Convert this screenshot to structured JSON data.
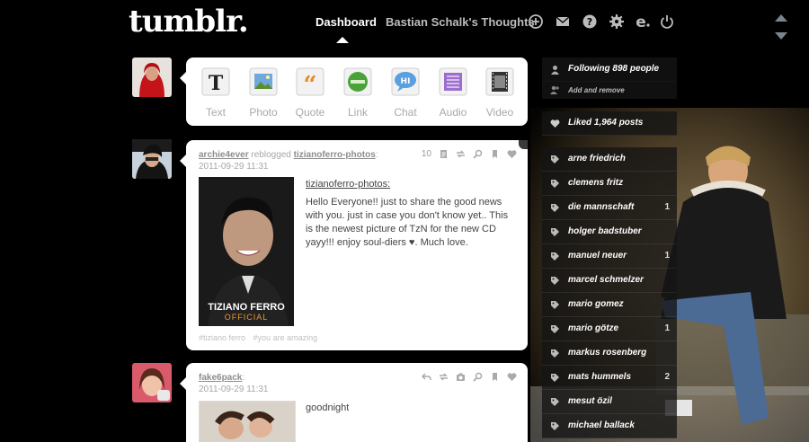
{
  "header": {
    "logo": "tumblr.",
    "nav_dashboard": "Dashboard",
    "nav_blog": "Bastian Schalk's Thoughts",
    "icons": [
      "plus-circle-icon",
      "mail-icon",
      "help-icon",
      "gear-icon",
      "edit-icon",
      "power-icon"
    ]
  },
  "post_types": [
    {
      "label": "Text",
      "icon": "text-icon"
    },
    {
      "label": "Photo",
      "icon": "photo-icon"
    },
    {
      "label": "Quote",
      "icon": "quote-icon"
    },
    {
      "label": "Link",
      "icon": "link-icon"
    },
    {
      "label": "Chat",
      "icon": "chat-icon"
    },
    {
      "label": "Audio",
      "icon": "audio-icon"
    },
    {
      "label": "Video",
      "icon": "video-icon"
    }
  ],
  "post1": {
    "user": "archie4ever",
    "action": "reblogged",
    "source_user": "tizianoferro-photos",
    "date": "2011-09-29 11:31",
    "note_count": "10",
    "source_link": "tizianoferro-photos",
    "body": "Hello Everyone!! just to share the good news with you. just in case you don't know yet.. This is the newest picture of TzN for the new CD yayy!!! enjoy soul-diers ♥. Much love.",
    "photo_caption_1": "TIZIANO FERRO",
    "photo_caption_2": "OFFICIAL",
    "tags": [
      "#tiziano ferro",
      "#you are amazing"
    ]
  },
  "post2": {
    "user": "fake6pack",
    "date": "2011-09-29 11:31",
    "body": "goodnight"
  },
  "sidebar": {
    "following": "Following 898 people",
    "add_remove": "Add and remove",
    "liked": "Liked 1,964 posts",
    "tags": [
      {
        "name": "arne friedrich",
        "count": ""
      },
      {
        "name": "clemens fritz",
        "count": ""
      },
      {
        "name": "die mannschaft",
        "count": "1"
      },
      {
        "name": "holger badstuber",
        "count": ""
      },
      {
        "name": "manuel neuer",
        "count": "1"
      },
      {
        "name": "marcel schmelzer",
        "count": ""
      },
      {
        "name": "mario gomez",
        "count": ""
      },
      {
        "name": "mario götze",
        "count": "1"
      },
      {
        "name": "markus rosenberg",
        "count": ""
      },
      {
        "name": "mats hummels",
        "count": "2"
      },
      {
        "name": "mesut özil",
        "count": ""
      },
      {
        "name": "michael ballack",
        "count": ""
      }
    ]
  }
}
